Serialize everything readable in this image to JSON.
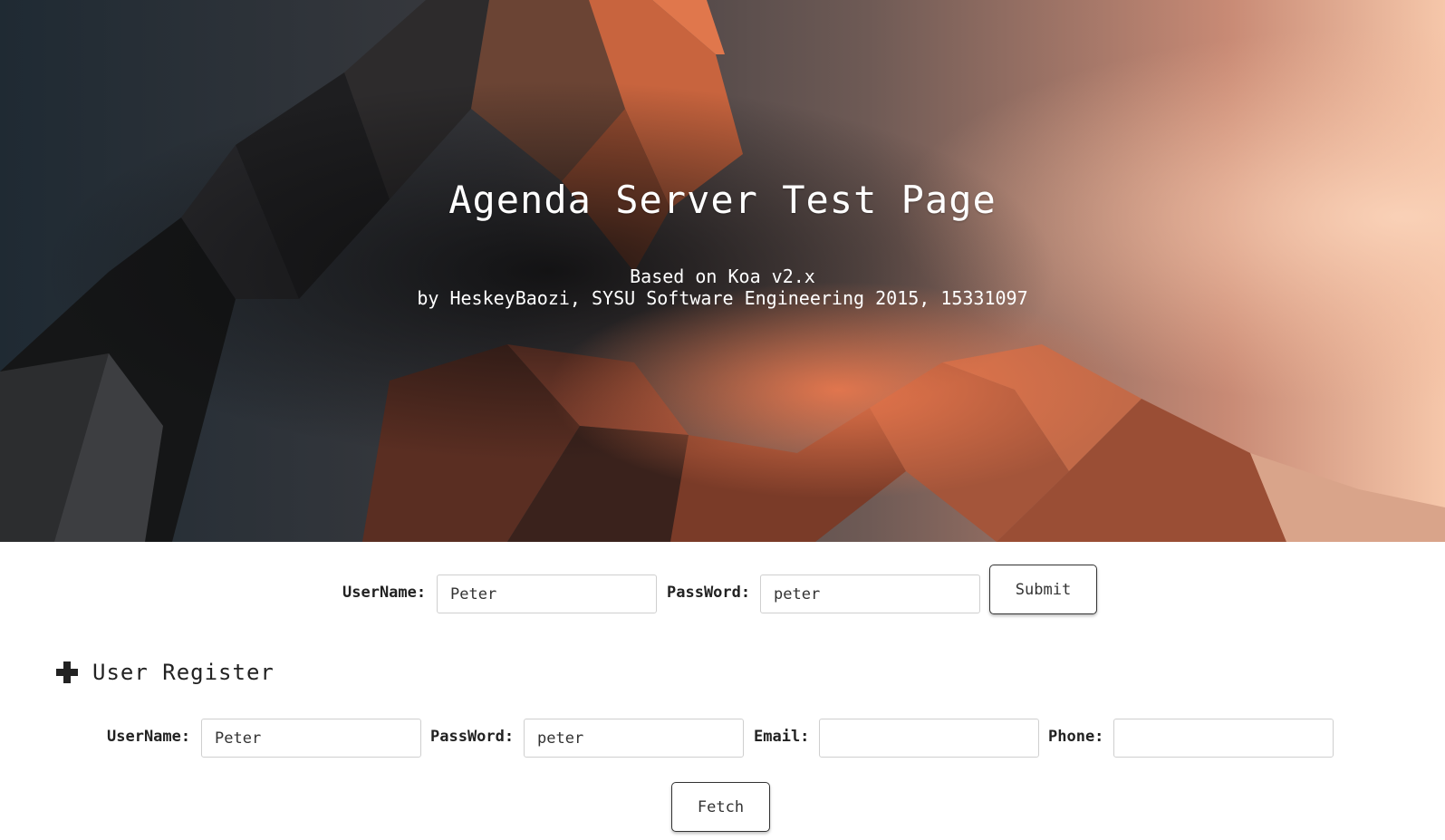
{
  "hero": {
    "title": "Agenda Server Test Page",
    "subtitle_line1": "Based on Koa v2.x",
    "subtitle_line2": "by HeskeyBaozi, SYSU Software Engineering 2015, 15331097",
    "colors": {
      "dark": "#22272e",
      "orange": "#e0744b",
      "peach": "#f6c4a6"
    }
  },
  "login": {
    "username_label": "UserName:",
    "username_value": "Peter",
    "password_label": "PassWord:",
    "password_value": "peter",
    "submit_label": "Submit"
  },
  "register": {
    "toggle_icon": "plus-icon",
    "title": "User Register",
    "username_label": "UserName:",
    "username_value": "Peter",
    "password_label": "PassWord:",
    "password_value": "peter",
    "email_label": "Email:",
    "email_value": "",
    "phone_label": "Phone:",
    "phone_value": "",
    "fetch_label": "Fetch"
  }
}
